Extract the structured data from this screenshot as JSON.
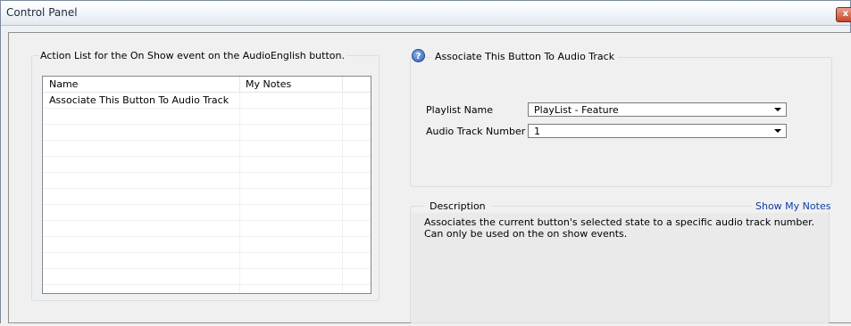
{
  "window": {
    "title": "Control Panel",
    "close_label": "x"
  },
  "action_list": {
    "group_title": "Action List for the On Show event on the AudioEnglish button.",
    "columns": [
      "Name",
      "My Notes"
    ],
    "rows": [
      [
        "Associate This Button To Audio Track",
        ""
      ]
    ]
  },
  "action_detail": {
    "group_title": "Associate This Button To Audio Track",
    "help_icon": "help-icon",
    "playlist_label": "Playlist Name",
    "playlist_value": "PlayList - Feature",
    "audio_track_label": "Audio Track Number",
    "audio_track_value": "1"
  },
  "description": {
    "title": "Description",
    "show_notes_label": "Show My Notes",
    "text": "Associates the current button's selected state to a specific audio track number. Can only be used on the on show events."
  },
  "colors": {
    "link": "#0b3ea8",
    "close_button": "#c8452a"
  }
}
